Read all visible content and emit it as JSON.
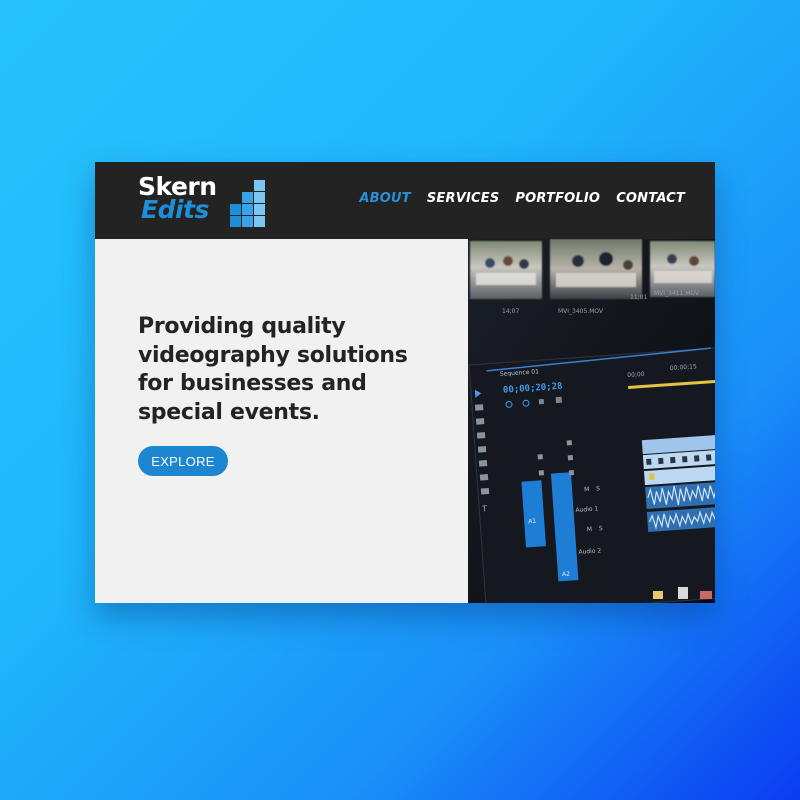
{
  "brand": {
    "name_line1": "Skern",
    "name_line2": "Edits",
    "accent_color": "#1d8fd8",
    "logo_icon": "stacked-blocks-icon"
  },
  "nav": {
    "items": [
      {
        "label": "ABOUT",
        "active": true
      },
      {
        "label": "SERVICES",
        "active": false
      },
      {
        "label": "PORTFOLIO",
        "active": false
      },
      {
        "label": "CONTACT",
        "active": false
      }
    ],
    "active_color": "#2a8fd6"
  },
  "hero": {
    "headline_lines": [
      "Providing quality",
      "videography solutions",
      "for businesses and",
      "special events."
    ],
    "cta_label": "EXPLORE",
    "cta_color": "#1d86d0"
  },
  "editor_image": {
    "clip_labels": [
      "MVI_3405.MOV",
      "MVI_3411.MOV"
    ],
    "timecode_small": [
      "14;07",
      "11;01"
    ],
    "sequence_label": "Sequence 01",
    "timecode": "00;00;20;28",
    "ruler_labels": [
      "00;00",
      "00;00;15"
    ],
    "track_labels": [
      "A1",
      "A2"
    ],
    "audio_labels": [
      "Audio 1",
      "Audio 2"
    ],
    "track_buttons": [
      "M",
      "S"
    ]
  }
}
